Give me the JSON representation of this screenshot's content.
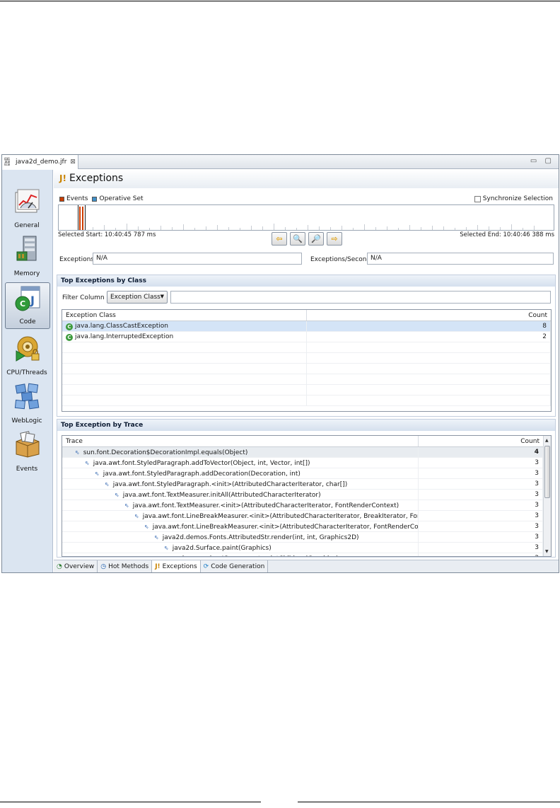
{
  "editor": {
    "tab_label": "java2d_demo.jfr",
    "tab_icon": "binary-file-icon",
    "close_glyph": "⊠",
    "window_controls": "▭ ▢"
  },
  "nav": {
    "items": [
      {
        "label": "General",
        "icon": "gauge-chart-icon",
        "selected": false
      },
      {
        "label": "Memory",
        "icon": "memory-chip-icon",
        "selected": false
      },
      {
        "label": "Code",
        "icon": "code-class-icon",
        "selected": true
      },
      {
        "label": "CPU/Threads",
        "icon": "cpu-gear-icon",
        "selected": false
      },
      {
        "label": "WebLogic",
        "icon": "weblogic-cubes-icon",
        "selected": false
      },
      {
        "label": "Events",
        "icon": "events-box-icon",
        "selected": false
      }
    ]
  },
  "page": {
    "title": "Exceptions",
    "legend_events": "Events",
    "legend_operative": "Operative Set",
    "sync_label": "Synchronize Selection",
    "selected_start": "Selected Start: 10:40:45 787 ms",
    "selected_end": "Selected End: 10:40:46 388 ms",
    "exceptions_label": "Exceptions",
    "exceptions_value": "N/A",
    "per_second_label": "Exceptions/Second",
    "per_second_value": "N/A"
  },
  "colors": {
    "events": "#c83c00",
    "operative_set": "#3f8fc8",
    "selection": "#d4e4f7"
  },
  "by_class": {
    "title": "Top Exceptions by Class",
    "filter_label": "Filter Column",
    "filter_value": "Exception Class",
    "columns": [
      "Exception Class",
      "Count"
    ],
    "rows": [
      {
        "name": "java.lang.ClassCastException",
        "count": "8"
      },
      {
        "name": "java.lang.InterruptedException",
        "count": "2"
      }
    ]
  },
  "by_trace": {
    "title": "Top Exception by Trace",
    "columns": [
      "Trace",
      "Count"
    ],
    "rows": [
      {
        "text": "sun.font.Decoration$DecorationImpl.equals(Object)",
        "count": "4"
      },
      {
        "text": "java.awt.font.StyledParagraph.addToVector(Object, int, Vector, int[])",
        "count": "3"
      },
      {
        "text": "java.awt.font.StyledParagraph.addDecoration(Decoration, int)",
        "count": "3"
      },
      {
        "text": "java.awt.font.StyledParagraph.<init>(AttributedCharacterIterator, char[])",
        "count": "3"
      },
      {
        "text": "java.awt.font.TextMeasurer.initAll(AttributedCharacterIterator)",
        "count": "3"
      },
      {
        "text": "java.awt.font.TextMeasurer.<init>(AttributedCharacterIterator, FontRenderContext)",
        "count": "3"
      },
      {
        "text": "java.awt.font.LineBreakMeasurer.<init>(AttributedCharacterIterator, BreakIterator, FontRende",
        "count": "3"
      },
      {
        "text": "java.awt.font.LineBreakMeasurer.<init>(AttributedCharacterIterator, FontRenderContext)",
        "count": "3"
      },
      {
        "text": "java2d.demos.Fonts.AttributedStr.render(int, int, Graphics2D)",
        "count": "3"
      },
      {
        "text": "java2d.Surface.paint(Graphics)",
        "count": "3"
      },
      {
        "text": "javax.swing.JComponent.paintChildren(Graphics)",
        "count": "3"
      }
    ]
  },
  "bottom_tabs": [
    {
      "label": "Overview",
      "icon": "overview-icon",
      "active": false
    },
    {
      "label": "Hot Methods",
      "icon": "hot-methods-icon",
      "active": false
    },
    {
      "label": "Exceptions",
      "icon": "exceptions-icon",
      "active": true
    },
    {
      "label": "Code Generation",
      "icon": "code-generation-icon",
      "active": false
    }
  ]
}
